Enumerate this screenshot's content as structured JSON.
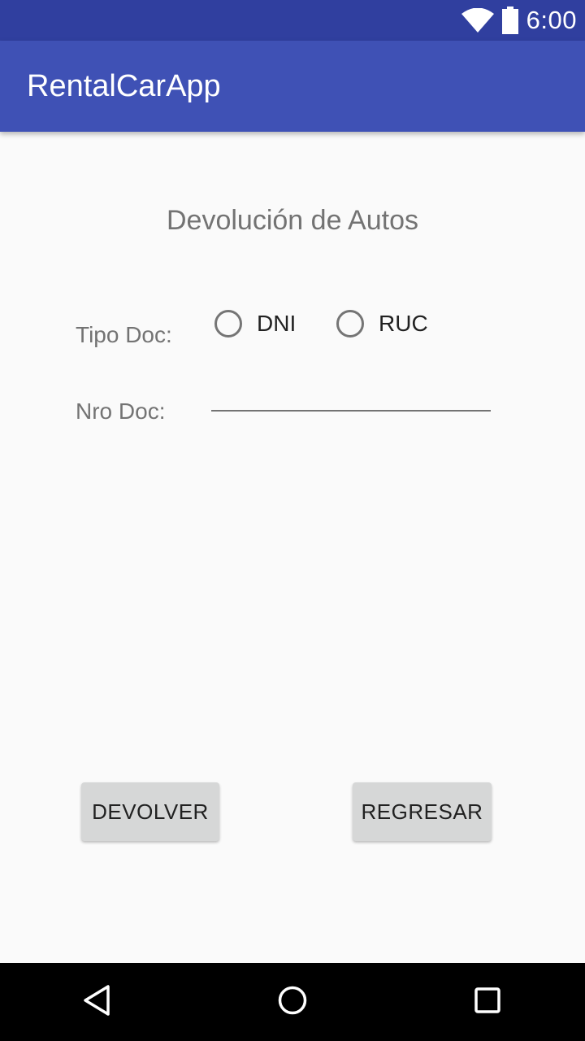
{
  "status_bar": {
    "time": "6:00",
    "icons": [
      "wifi-icon",
      "battery-icon"
    ]
  },
  "app_bar": {
    "title": "RentalCarApp"
  },
  "form": {
    "title": "Devolución de Autos",
    "doc_type_label": "Tipo Doc:",
    "doc_type_options": [
      {
        "label": "DNI",
        "selected": false
      },
      {
        "label": "RUC",
        "selected": false
      }
    ],
    "doc_number_label": "Nro Doc:",
    "doc_number_value": ""
  },
  "buttons": {
    "return_label": "DEVOLVER",
    "back_label": "REGRESAR"
  },
  "nav_bar": {
    "icons": [
      "back-icon",
      "home-icon",
      "recents-icon"
    ]
  },
  "colors": {
    "status_bar": "#303f9f",
    "app_bar": "#3f51b5",
    "background": "#fafafa",
    "button": "#d6d7d7"
  }
}
